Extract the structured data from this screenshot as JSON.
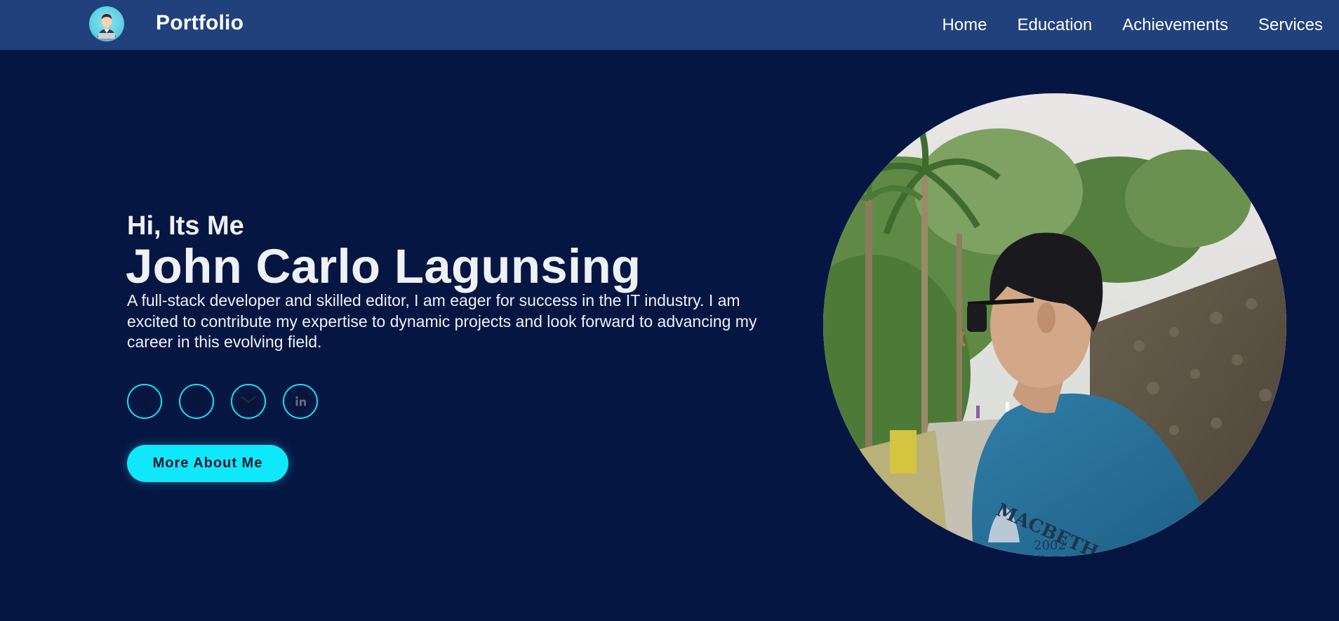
{
  "header": {
    "brand": "Portfolio",
    "logo_icon": "developer-avatar-icon",
    "nav": [
      {
        "label": "Home"
      },
      {
        "label": "Education"
      },
      {
        "label": "Achievements"
      },
      {
        "label": "Services"
      }
    ]
  },
  "hero": {
    "greeting": "Hi, Its Me",
    "name": "John Carlo Lagunsing",
    "bio": "A full-stack developer and skilled editor, I am eager for success in the IT industry. I am excited to contribute my expertise to dynamic projects and look forward to advancing my career in this evolving field.",
    "socials": [
      {
        "icon": "facebook-icon"
      },
      {
        "icon": "instagram-icon"
      },
      {
        "icon": "email-icon"
      },
      {
        "icon": "linkedin-icon"
      }
    ],
    "cta_label": "More About Me",
    "photo_shirt_text": "MACBETH",
    "photo_shirt_number": "2002"
  },
  "colors": {
    "background": "#061642",
    "navbar": "#21417d",
    "accent": "#0fe8fb",
    "text": "#eef1f6"
  }
}
